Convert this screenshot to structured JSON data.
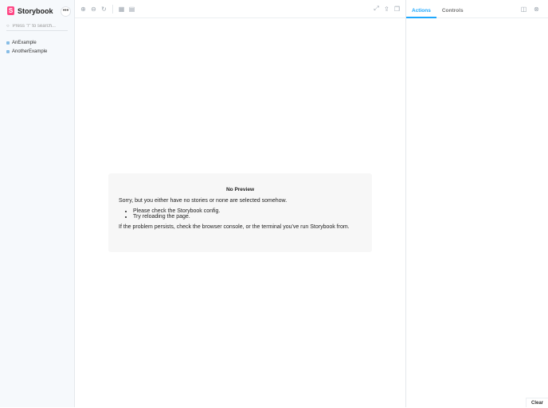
{
  "sidebar": {
    "logo_letter": "S",
    "brand": "Storybook",
    "menu_label": "•••",
    "search_placeholder": "Press \"/\" to search...",
    "items": [
      {
        "label": "AnExample"
      },
      {
        "label": "AnotherExample"
      }
    ]
  },
  "toolbar": {
    "icons": [
      "zoom-in-icon",
      "zoom-out-icon",
      "zoom-reset-icon",
      "grid-icon",
      "background-icon",
      "fullscreen-icon",
      "share-icon",
      "copy-icon"
    ]
  },
  "preview": {
    "title": "No Preview",
    "message": "Sorry, but you either have no stories or none are selected somehow.",
    "tips": [
      "Please check the Storybook config.",
      "Try reloading the page."
    ],
    "footer": "If the problem persists, check the browser console, or the terminal you've run Storybook from."
  },
  "panel": {
    "tabs": [
      {
        "label": "Actions",
        "active": true
      },
      {
        "label": "Controls",
        "active": false
      }
    ],
    "clear_label": "Clear"
  },
  "colors": {
    "accent": "#1ea7fd",
    "brand": "#ff4785"
  }
}
